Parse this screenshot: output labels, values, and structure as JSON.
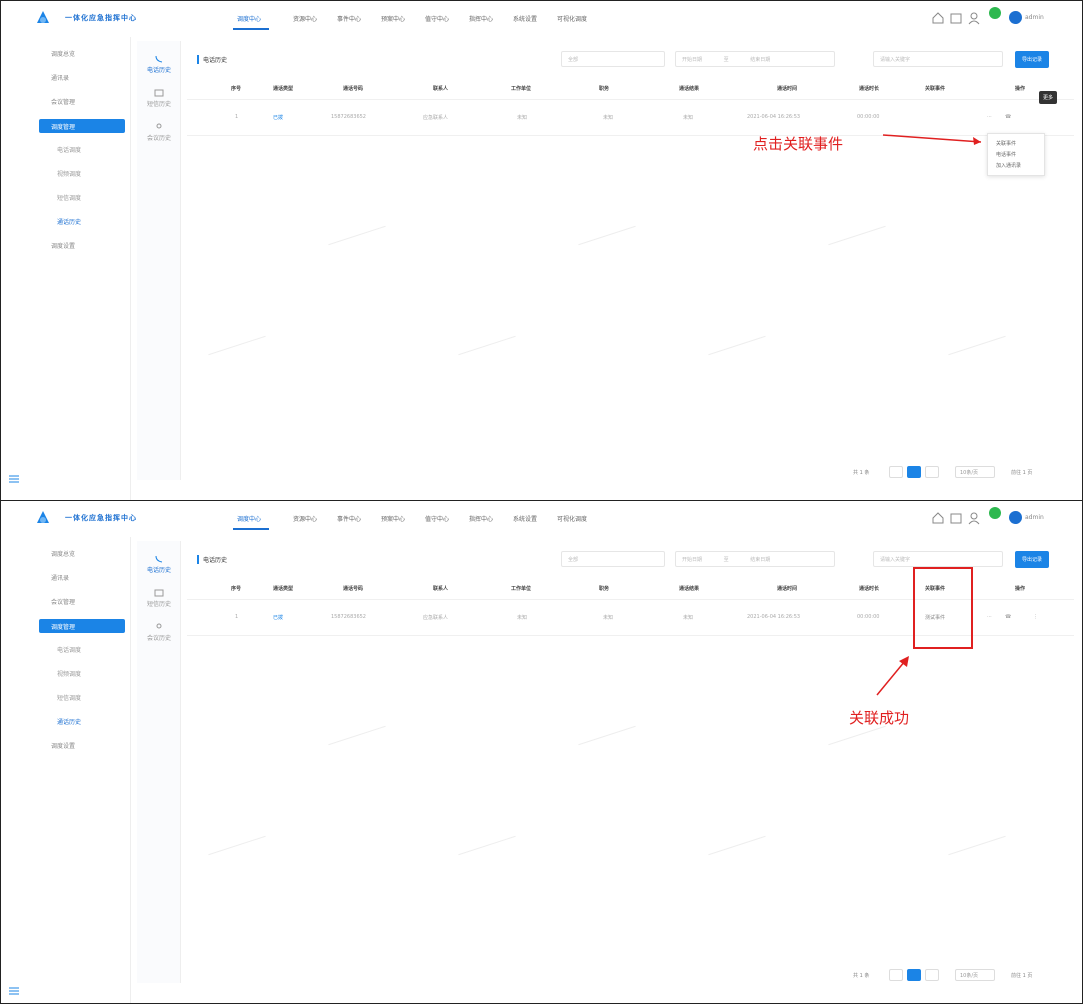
{
  "app": {
    "title": "一体化应急指挥中心",
    "user": "admin"
  },
  "nav": [
    "调度中心",
    "资源中心",
    "事件中心",
    "预案中心",
    "值守中心",
    "指挥中心",
    "系统设置",
    "可视化调度"
  ],
  "sidebar": {
    "items": [
      "调度总览",
      "通讯录",
      "会议管理"
    ],
    "active": "调度管理",
    "subitems": [
      "电话调度",
      "视频调度",
      "短信调度",
      "通话历史"
    ],
    "last": "调度设置"
  },
  "subnav": [
    "电话历史",
    "短信历史",
    "会议历史"
  ],
  "content": {
    "section_title": "电话历史",
    "filter_type": "全部",
    "date_start": "开始日期",
    "date_sep": "至",
    "date_end": "结束日期",
    "search_placeholder": "请输入关键字",
    "export_label": "导出记录"
  },
  "table": {
    "columns": [
      "序号",
      "通话类型",
      "通话号码",
      "联系人",
      "工作单位",
      "职务",
      "通话结果",
      "通话时间",
      "通话时长",
      "关联事件",
      "操作"
    ],
    "row": [
      "1",
      "已拨",
      "15872683652",
      "应急联系人",
      "未知",
      "未知",
      "未知",
      "2021-06-04 16:26:53",
      "00:00:00",
      "",
      ""
    ],
    "row_after": [
      "1",
      "已拨",
      "15872683652",
      "应急联系人",
      "未知",
      "未知",
      "未知",
      "2021-06-04 16:26:53",
      "00:00:00",
      "测试事件",
      ""
    ]
  },
  "tooltip": "更多",
  "dropdown": [
    "关联事件",
    "电话事件",
    "加入通讯录"
  ],
  "annotations": {
    "step1": "点击关联事件",
    "step2": "关联成功"
  },
  "pager": {
    "total": "共 1 条",
    "page": "1",
    "size": "10条/页",
    "goto": "前往 1 页"
  },
  "colors": {
    "accent": "#1b84e6",
    "annotation": "#e02020"
  }
}
